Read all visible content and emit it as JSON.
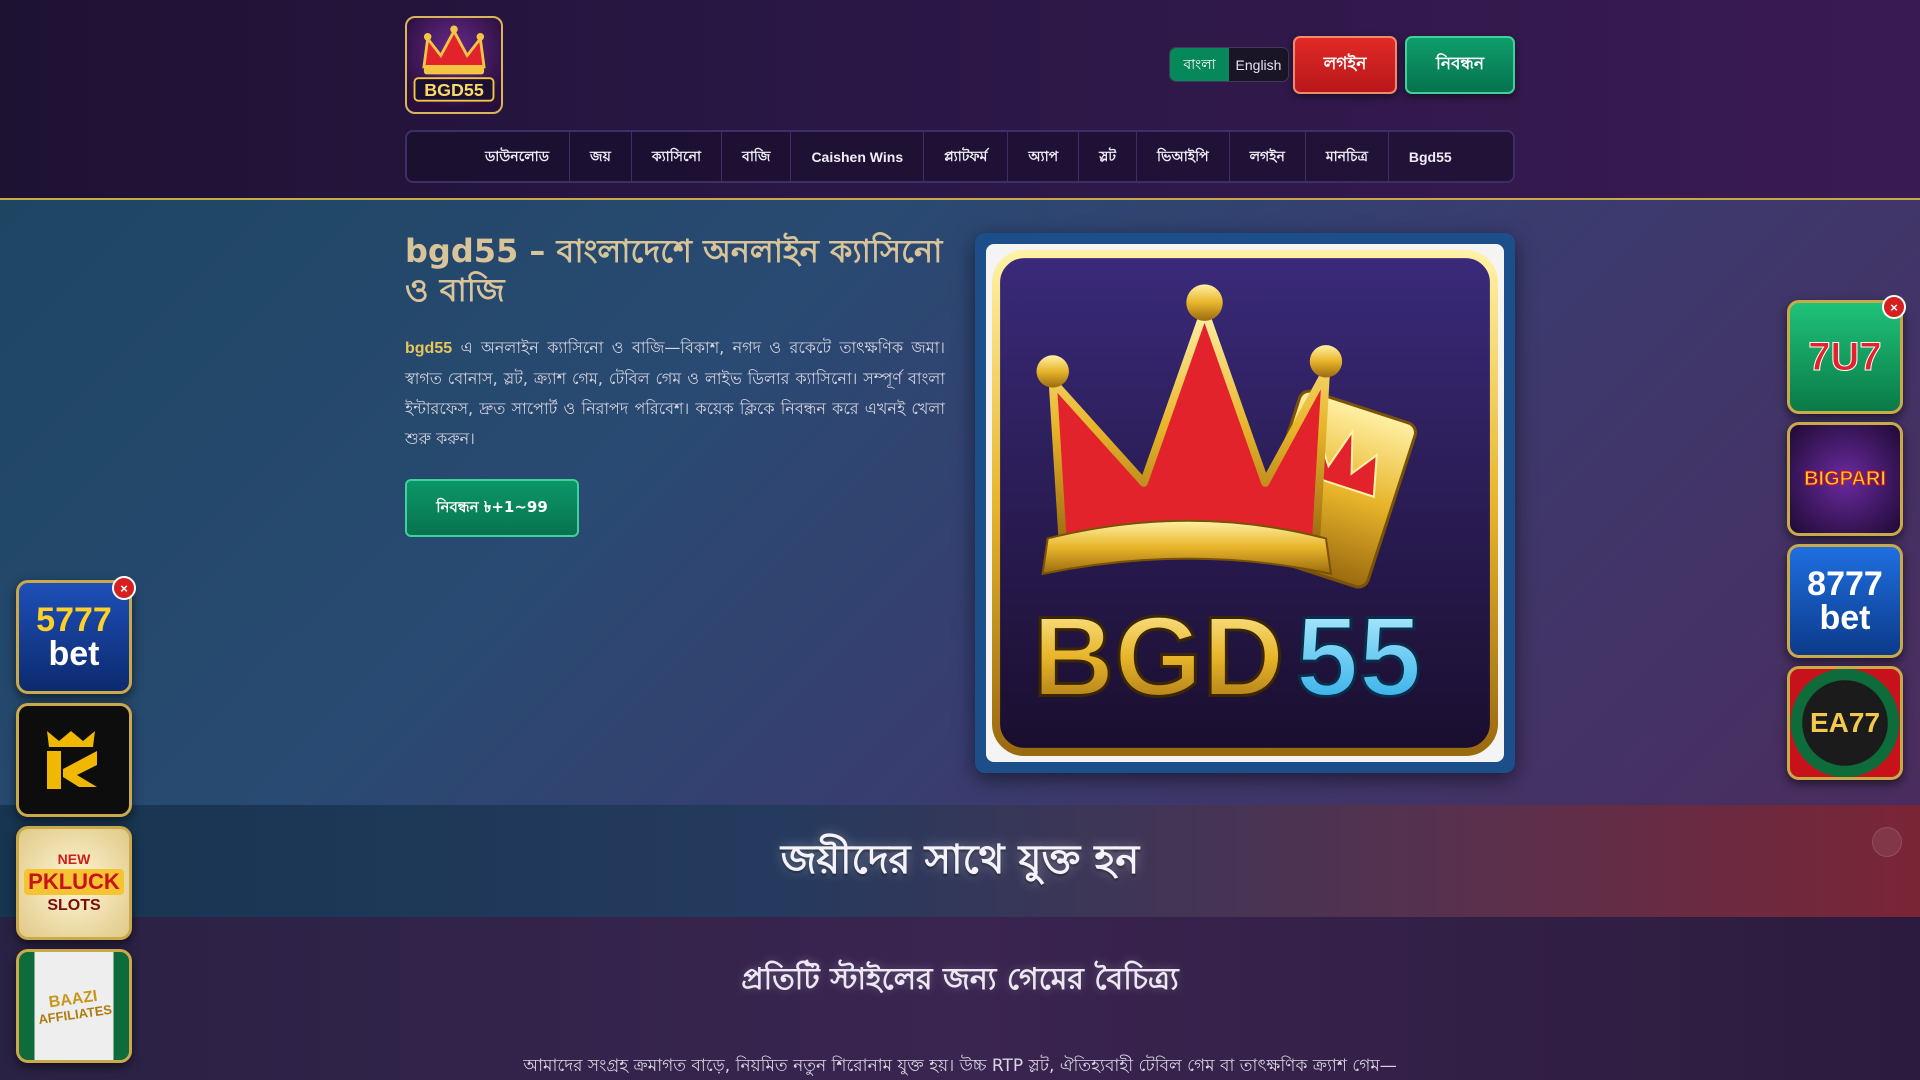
{
  "header": {
    "logo_text": "BGD55",
    "lang": {
      "bn": "বাংলা",
      "en": "English"
    },
    "login_label": "লগইন",
    "register_label": "নিবন্ধন"
  },
  "nav": {
    "items": [
      "ডাউনলোড",
      "জয়",
      "ক্যাসিনো",
      "বাজি",
      "Caishen Wins",
      "প্ল্যাটফর্ম",
      "অ্যাপ",
      "স্লট",
      "ভিআইপি",
      "লগইন",
      "মানচিত্র",
      "Bgd55"
    ]
  },
  "hero": {
    "title": "bgd55 – বাংলাদেশে অনলাইন ক্যাসিনো ও বাজি",
    "desc_brand": "bgd55",
    "desc_text": " এ অনলাইন ক্যাসিনো ও বাজি—বিকাশ, নগদ ও রকেটে তাৎক্ষণিক জমা। স্বাগত বোনাস, স্লট, ক্র্যাশ গেম, টেবিল গেম ও লাইভ ডিলার ক্যাসিনো। সম্পূর্ণ বাংলা ইন্টারফেস, দ্রুত সাপোর্ট ও নিরাপদ পরিবেশ। কয়েক ক্লিকে নিবন্ধন করে এখনই খেলা শুরু করুন।",
    "cta_label": "নিবন্ধন ৳+1~99",
    "image_text": "BGD55"
  },
  "join": {
    "title": "জয়ীদের সাথে যুক্ত হন"
  },
  "variety": {
    "title": "প্রতিটি স্টাইলের জন্য গেমের বৈচিত্র্য",
    "text": "আমাদের সংগ্রহ ক্রমাগত বাড়ে, নিয়মিত নতুন শিরোনাম যুক্ত হয়। উচ্চ RTP স্লট, ঐতিহ্যবাহী টেবিল গেম বা তাৎক্ষণিক ক্র্যাশ গেম—"
  },
  "ads_left": [
    {
      "name": "5777bet",
      "line1": "5777",
      "line2": "bet"
    },
    {
      "name": "k-logo",
      "line1": "",
      "line2": ""
    },
    {
      "name": "new-pkluck-slots",
      "line1": "NEW",
      "line2": "PKLUCK",
      "line3": "SLOTS"
    },
    {
      "name": "baazi-affiliates",
      "line1": "BAAZI",
      "line2": "AFFILIATES"
    }
  ],
  "ads_right": [
    {
      "name": "7u7",
      "line1": "7U7"
    },
    {
      "name": "bigpari",
      "line1": "BIGPARI"
    },
    {
      "name": "8777bet",
      "line1": "8777",
      "line2": "bet"
    },
    {
      "name": "ea77",
      "line1": "EA77"
    }
  ],
  "close_symbol": "×",
  "colors": {
    "accent_gold": "#c9a94a",
    "login_red": "#d6221f",
    "register_green": "#0a8a5e"
  }
}
